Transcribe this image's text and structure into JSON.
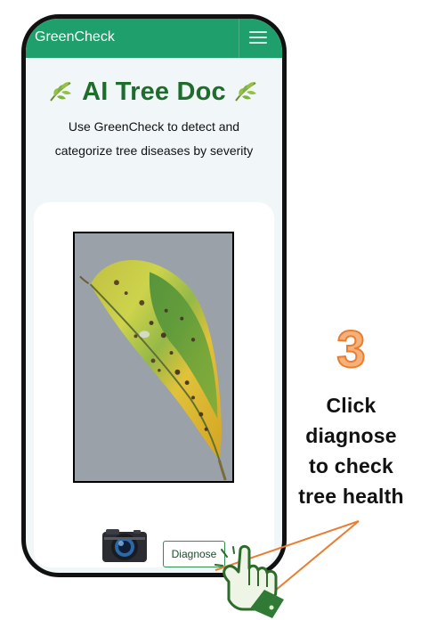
{
  "window": {
    "brand": "GreenCheck",
    "menu_icon": "hamburger-menu-icon"
  },
  "hero": {
    "title": "AI Tree Doc",
    "subtitle": "Use GreenCheck to detect and categorize tree diseases by severity",
    "left_icon": "leaf-emoji-icon",
    "right_icon": "leaf-emoji-icon"
  },
  "card": {
    "camera_icon": "camera-icon",
    "diagnose_label": "Diagnose"
  },
  "annotation": {
    "step": "3",
    "text": "Click\ndiagnose\nto check\ntree health"
  },
  "colors": {
    "topbar": "#1f9f6b",
    "title": "#1e6d2d",
    "accent_orange": "#ea7d2f",
    "accent_peach": "#f6b17a"
  }
}
